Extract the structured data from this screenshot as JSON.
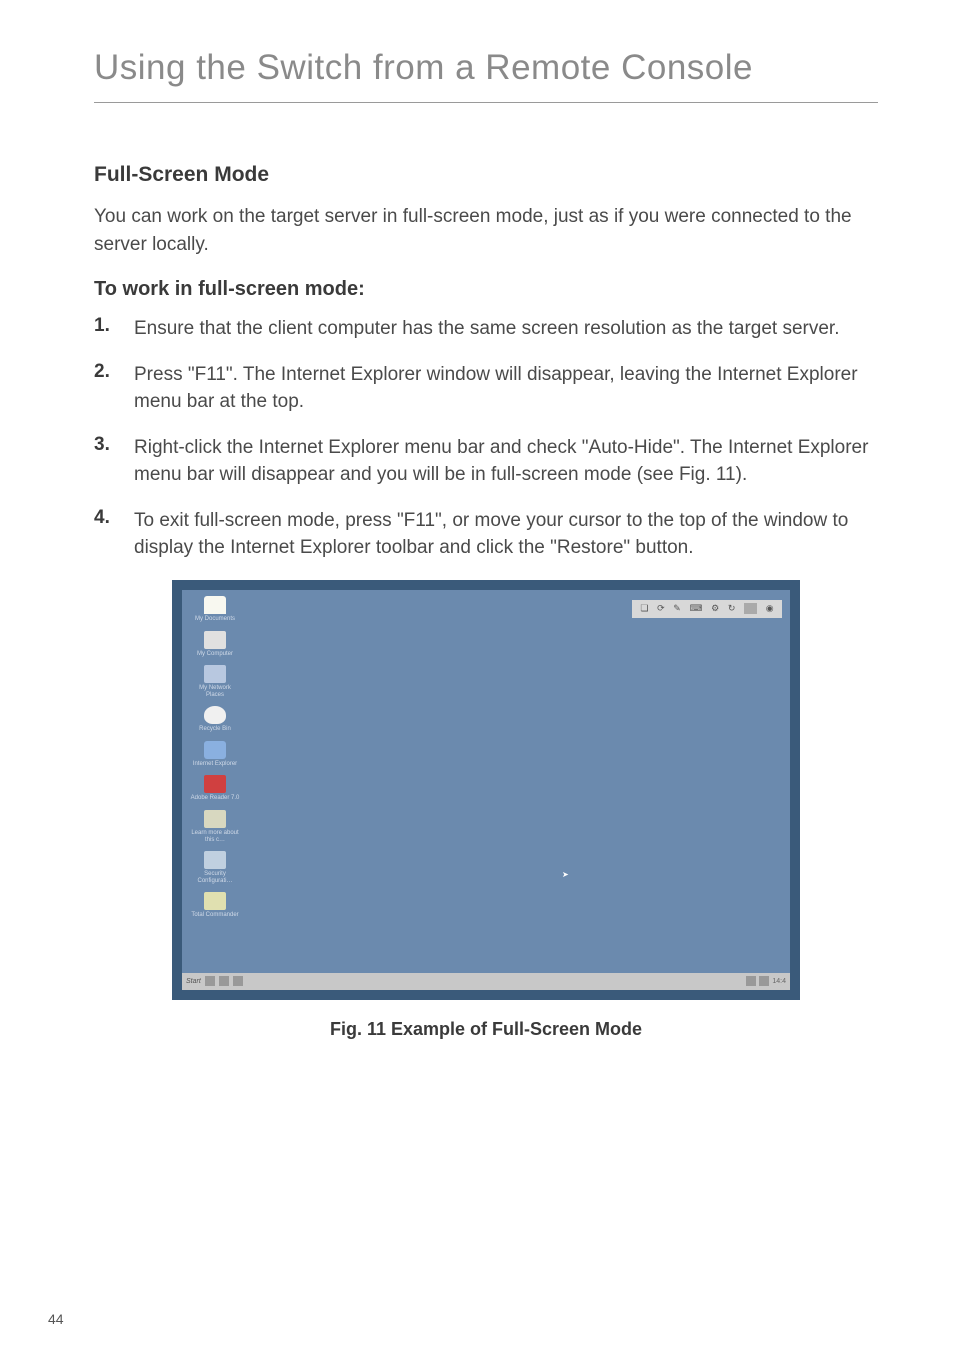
{
  "chapter_title": "Using the Switch from a Remote Console",
  "section_title": "Full-Screen Mode",
  "intro_text": "You can work on the target server in full-screen mode, just as if you were connected to the server locally.",
  "sub_title": "To work in full-screen mode:",
  "steps": [
    {
      "num": "1.",
      "text": "Ensure that the client computer has the same screen resolution as the target server."
    },
    {
      "num": "2.",
      "text": "Press \"F11\". The Internet Explorer window will disappear, leaving the Internet Explorer menu bar at the top."
    },
    {
      "num": "3.",
      "text": "Right-click the Internet Explorer menu bar and check \"Auto-Hide\". The Internet Explorer menu bar will disappear and you will be in full-screen mode (see Fig. 11)."
    },
    {
      "num": "4.",
      "text": "To exit full-screen mode, press \"F11\", or move your cursor to the top of the window to display the Internet Explorer toolbar and click the \"Restore\" button."
    }
  ],
  "figure": {
    "caption": "Fig. 11 Example of Full-Screen Mode",
    "desktop_icons": [
      "My Documents",
      "My Computer",
      "My Network Places",
      "Recycle Bin",
      "Internet Explorer",
      "Adobe Reader 7.0",
      "Learn more about this c…",
      "Security Configurati…",
      "Total Commander"
    ],
    "taskbar_start": "Start",
    "taskbar_time": "14:4"
  },
  "page_number": "44"
}
